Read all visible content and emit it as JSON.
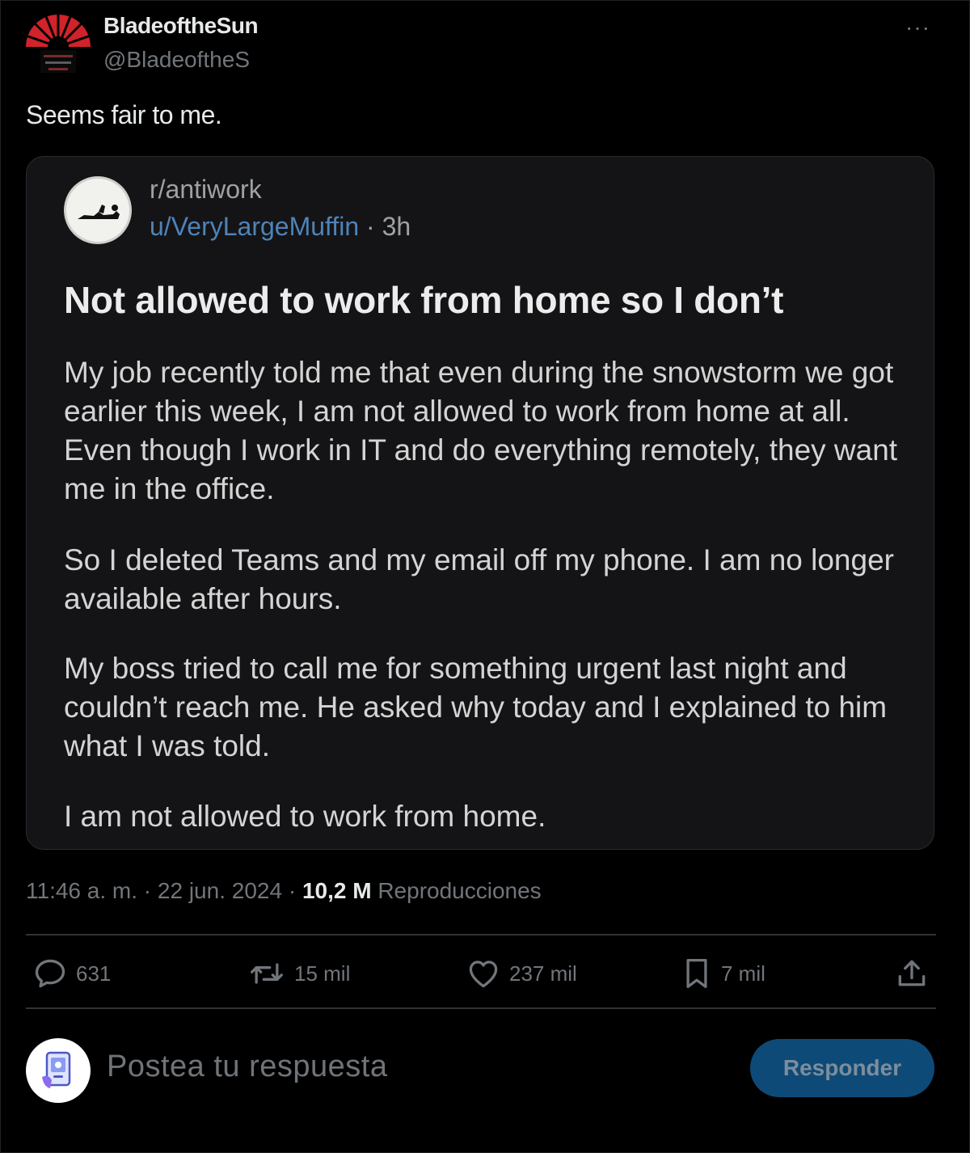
{
  "post": {
    "display_name": "BladeoftheSun",
    "handle": "@BladeoftheS",
    "more_label": "···",
    "text": "Seems fair to me."
  },
  "embed": {
    "subreddit": "r/antiwork",
    "user": "u/VeryLargeMuffin",
    "separator": " · ",
    "age": "3h",
    "title": "Not allowed to work from home so I don’t",
    "paragraphs": [
      "My job recently told me that even during the snowstorm we got earlier this week, I am not allowed to work from home at all. Even though I work in IT and do everything remotely, they want me in the office.",
      "So I deleted Teams and my email off my phone. I am no longer available after hours.",
      "My boss tried to call me for something urgent last night and couldn’t reach me. He asked why today and I explained to him what I was told.",
      "I am not allowed to work from home."
    ]
  },
  "meta": {
    "time": "11:46 a. m.",
    "sep": " · ",
    "date": "22 jun. 2024",
    "views_count": "10,2 M",
    "views_label": "Reproducciones"
  },
  "actions": {
    "replies": "631",
    "reposts": "15 mil",
    "likes": "237 mil",
    "bookmarks": "7 mil"
  },
  "composer": {
    "placeholder": "Postea tu respuesta",
    "button": "Responder"
  },
  "colors": {
    "background": "#000000",
    "link": "#4e83b8",
    "button": "#0e4a78",
    "avatar_red": "#d0232a"
  },
  "icons": {
    "reply": "speech-bubble-icon",
    "repost": "repost-arrows-icon",
    "like": "heart-icon",
    "bookmark": "bookmark-icon",
    "share": "share-upload-icon"
  }
}
